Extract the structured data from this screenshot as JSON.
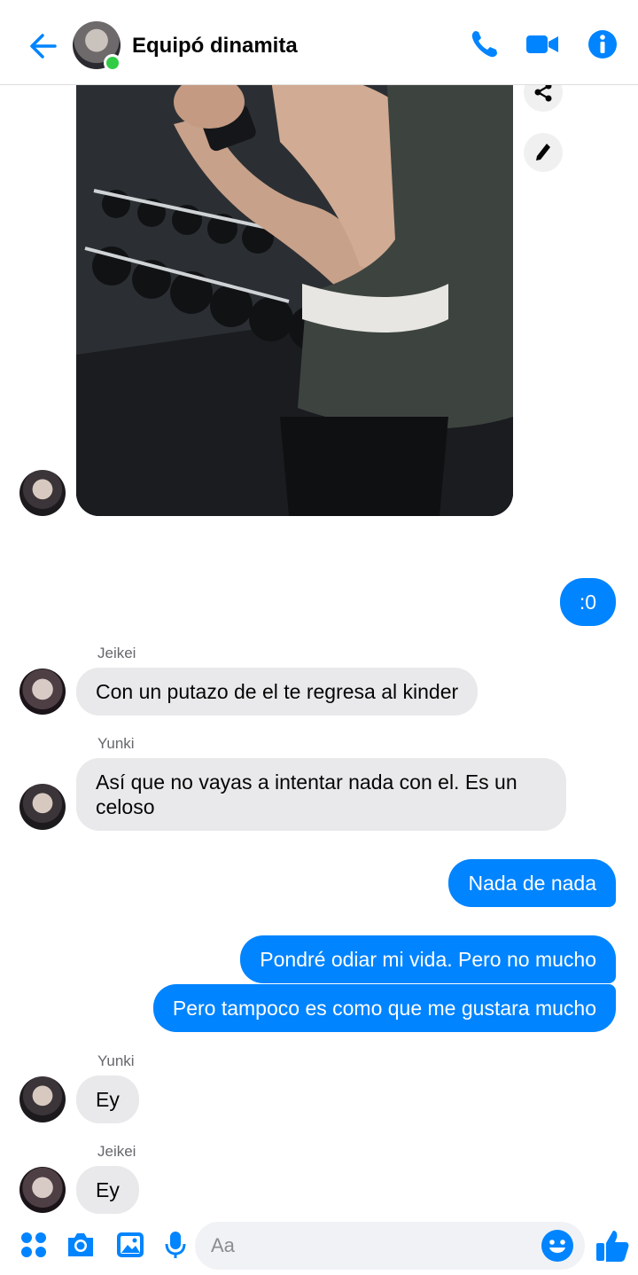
{
  "header": {
    "title": "Equipó dinamita",
    "accent": "#0084ff",
    "online_color": "#31cc46"
  },
  "messages": [
    {
      "from": "Yunki",
      "type": "image",
      "description_icon": "photo-message"
    },
    {
      "from": "me",
      "text": ":0"
    },
    {
      "from": "Jeikei",
      "sender_label": "Jeikei",
      "text": "Con un putazo de el te regresa al kinder"
    },
    {
      "from": "Yunki",
      "sender_label": "Yunki",
      "text": "Así que no vayas a intentar nada con el. Es un",
      "text2": "celoso"
    },
    {
      "from": "me",
      "text": "Nada de nada"
    },
    {
      "from": "me",
      "text": "Pondré odiar mi vida. Pero no mucho"
    },
    {
      "from": "me",
      "text": "Pero tampoco es como que me gustara mucho"
    },
    {
      "from": "Yunki",
      "sender_label": "Yunki",
      "text": "Ey"
    },
    {
      "from": "Jeikei",
      "sender_label": "Jeikei",
      "text": "Ey"
    }
  ],
  "composer": {
    "placeholder": "Aa"
  }
}
